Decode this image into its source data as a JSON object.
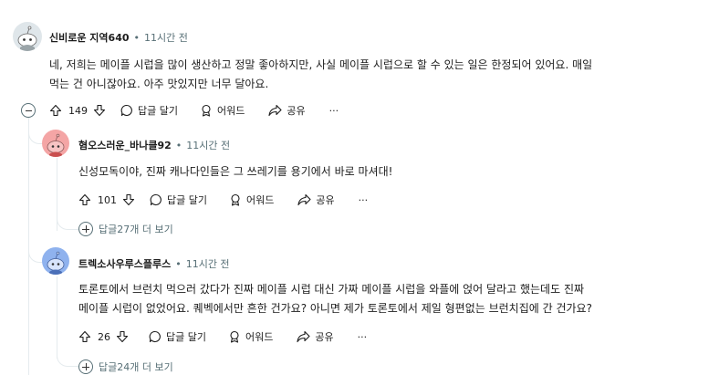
{
  "comments": [
    {
      "username": "신비로운 지역640",
      "time": "11시간 전",
      "body_line1": "네, 저희는 메이플 시럽을 많이 생산하고 정말 좋아하지만, 사실 메이플 시럽으로 할 수 있는 일은 한정되어 있어요. 매일",
      "body_line2": "먹는 건 아니잖아요. 아주 맛있지만 너무 달아요.",
      "votes": "149",
      "reply_label": "답글 달기",
      "award_label": "어워드",
      "share_label": "공유",
      "more_label": "···"
    },
    {
      "username": "혐오스러운_바나클92",
      "time": "11시간 전",
      "body_line1": "신성모독이야, 진짜 캐나다인들은 그 쓰레기를 용기에서 바로 마셔대!",
      "votes": "101",
      "reply_label": "답글 달기",
      "award_label": "어워드",
      "share_label": "공유",
      "more_label": "···",
      "more_replies": "답글27개 더 보기"
    },
    {
      "username": "트렉소사우루스플루스",
      "time": "11시간 전",
      "body_line1": "토론토에서 브런치 먹으러 갔다가 진짜 메이플 시럽 대신 가짜 메이플 시럽을 와플에 얹어 달라고 했는데도 진짜",
      "body_line2": "메이플 시럽이 없었어요. 퀘벡에서만 흔한 건가요? 아니면 제가 토론토에서 제일 형편없는 브런치집에 간 건가요?",
      "votes": "26",
      "reply_label": "답글 달기",
      "award_label": "어워드",
      "share_label": "공유",
      "more_label": "···",
      "more_replies": "답글24개 더 보기"
    }
  ],
  "dot": "•",
  "icons": [
    "upvote-icon",
    "downvote-icon",
    "comment-icon",
    "award-icon",
    "share-icon",
    "collapse-icon",
    "expand-icon"
  ],
  "colors": {
    "muted": "#576f76",
    "thread_line": "#e5ebee",
    "avatar1_bg": "#dfe6ea",
    "avatar2_bg": "#f4a5a5",
    "avatar3_bg": "#8fb2ee"
  }
}
